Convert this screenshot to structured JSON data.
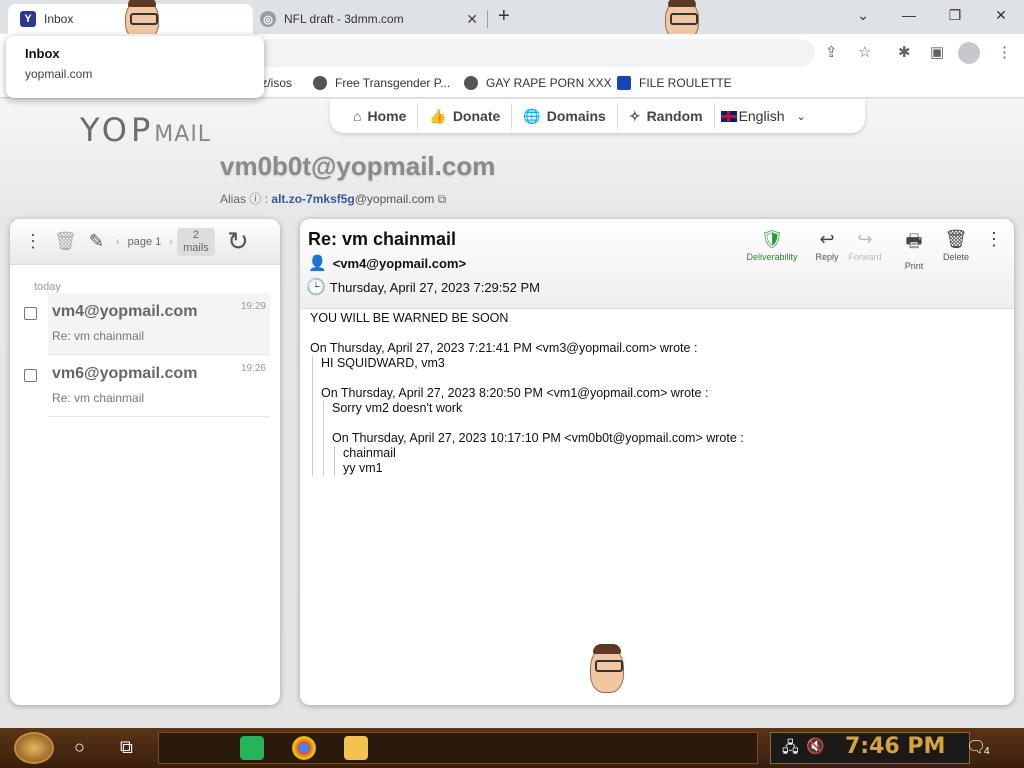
{
  "browser": {
    "tabs": [
      {
        "title": "Inbox",
        "icon": "yopmail-favicon",
        "favicon_letter": "Y"
      },
      {
        "title": "NFL draft - 3dmm.com",
        "icon": "globe-favicon"
      }
    ],
    "tooltip": {
      "title": "Inbox",
      "domain": "yopmail.com"
    },
    "omnibox_fragment": "tz/isos",
    "bookmarks": [
      {
        "label": "Free Transgender P..."
      },
      {
        "label": "GAY RAPE PORN XXX"
      },
      {
        "label": "FILE ROULETTE"
      }
    ]
  },
  "site": {
    "logo_a": "YOP",
    "logo_b": "MAIL",
    "nav": [
      {
        "label": "Home",
        "icon": "home-icon"
      },
      {
        "label": "Donate",
        "icon": "thumbs-up-icon"
      },
      {
        "label": "Domains",
        "icon": "globe-icon"
      },
      {
        "label": "Random",
        "icon": "magic-wand-icon"
      }
    ],
    "language": "English",
    "email": "vm0b0t@yopmail.com",
    "alias_label": "Alias",
    "alias_value": "alt.zo-7mksf5g",
    "alias_domain": "@yopmail.com"
  },
  "inbox": {
    "page_label": "page 1",
    "count_num": "2",
    "count_word": "mails",
    "group": "today",
    "mails": [
      {
        "from": "vm4@yopmail.com",
        "subject": "Re: vm chainmail",
        "time": "19:29",
        "selected": true
      },
      {
        "from": "vm6@yopmail.com",
        "subject": "Re: vm chainmail",
        "time": "19:26",
        "selected": false
      }
    ]
  },
  "message": {
    "subject": "Re: vm chainmail",
    "from": "<vm4@yopmail.com>",
    "date": "Thursday, April 27, 2023 7:29:52 PM",
    "actions": {
      "deliverability": "Deliverability",
      "reply": "Reply",
      "forward": "Forward",
      "print": "Print",
      "delete": "Delete"
    },
    "body": {
      "line1": "YOU WILL BE WARNED BE SOON",
      "q1_header": "On Thursday, April 27, 2023 7:21:41 PM <vm3@yopmail.com> wrote :",
      "q1_text": "HI SQUIDWARD, vm3",
      "q2_header": "On Thursday, April 27, 2023 8:20:50 PM <vm1@yopmail.com> wrote :",
      "q2_text": "Sorry vm2 doesn't work",
      "q3_header": "On Thursday, April 27, 2023 10:17:10 PM <vm0b0t@yopmail.com> wrote :",
      "q3_text1": "chainmail",
      "q3_text2": "yy vm1"
    }
  },
  "taskbar": {
    "clock": "7:46 PM",
    "notification_count": "4"
  },
  "colors": {
    "accent_green": "#2a9a3a",
    "alias_blue": "#3556a8",
    "clock_gold": "#d9a240"
  }
}
